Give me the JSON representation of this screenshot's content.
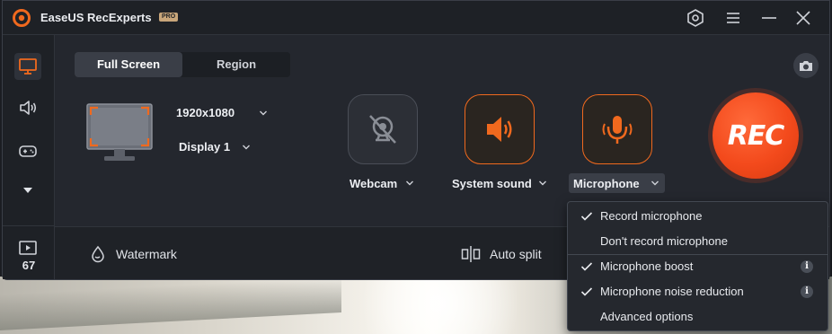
{
  "app": {
    "title": "EaseUS RecExperts",
    "badge": "PRO",
    "accent_color": "#f0691e",
    "window_controls": [
      "settings-icon",
      "menu-icon",
      "minimize-icon",
      "close-icon"
    ]
  },
  "sidebar": {
    "items": [
      {
        "name": "screen",
        "icon": "monitor-icon",
        "active": true
      },
      {
        "name": "audio",
        "icon": "speaker-icon",
        "active": false
      },
      {
        "name": "game",
        "icon": "gamepad-icon",
        "active": false
      },
      {
        "name": "more",
        "icon": "caret-down-icon",
        "active": false
      }
    ],
    "recordings_count": "67"
  },
  "capture": {
    "tabs": [
      {
        "label": "Full Screen",
        "active": true
      },
      {
        "label": "Region",
        "active": false
      }
    ],
    "resolution": "1920x1080",
    "display": "Display 1"
  },
  "devices": {
    "webcam": {
      "label": "Webcam",
      "enabled": false
    },
    "system_sound": {
      "label": "System sound",
      "enabled": true
    },
    "microphone": {
      "label": "Microphone",
      "enabled": true
    }
  },
  "rec_button": {
    "label": "REC"
  },
  "bottombar": {
    "watermark": "Watermark",
    "auto_split": "Auto split"
  },
  "mic_menu": {
    "items": [
      {
        "label": "Record microphone",
        "checked": true,
        "info": false
      },
      {
        "label": "Don't record microphone",
        "checked": false,
        "info": false
      },
      {
        "label": "Microphone boost",
        "checked": true,
        "info": true
      },
      {
        "label": "Microphone noise reduction",
        "checked": true,
        "info": true
      },
      {
        "label": "Advanced options",
        "checked": false,
        "info": false
      }
    ],
    "info_glyph": "i"
  }
}
